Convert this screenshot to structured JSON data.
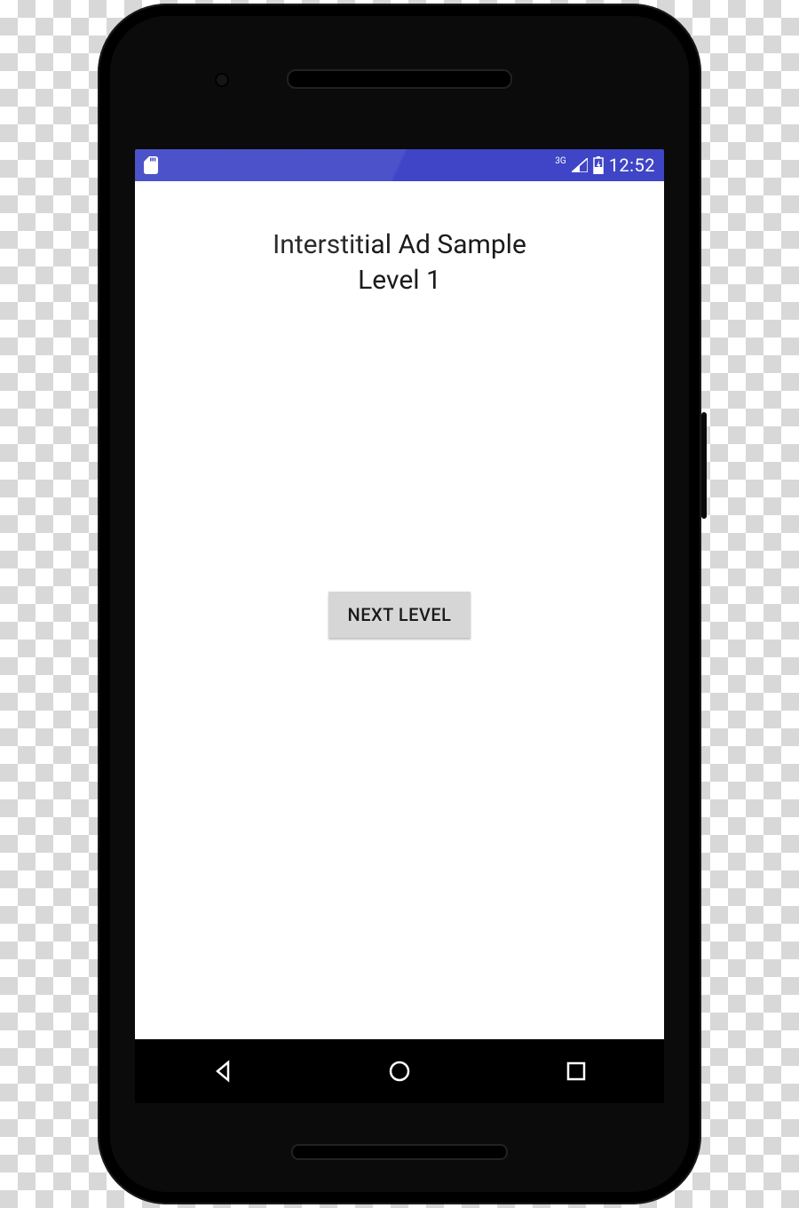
{
  "status_bar": {
    "network_label": "3G",
    "time": "12:52"
  },
  "app": {
    "title_line1": "Interstitial Ad Sample",
    "title_line2": "Level 1",
    "next_button_label": "NEXT LEVEL"
  },
  "colors": {
    "status_bar_bg": "#3f45c6",
    "button_bg": "#d6d6d6"
  }
}
